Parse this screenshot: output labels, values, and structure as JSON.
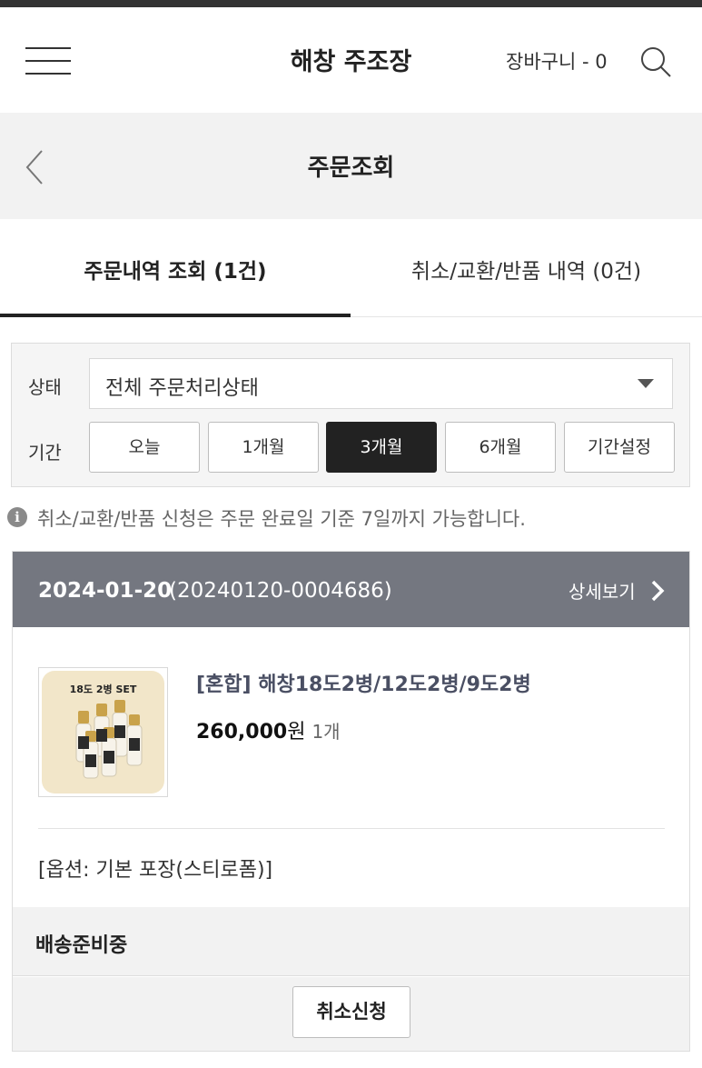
{
  "header": {
    "brand": "해창 주조장",
    "cart_label": "장바구니 - 0"
  },
  "subheader": {
    "title": "주문조회"
  },
  "tabs": [
    {
      "label": "주문내역 조회 (1건)",
      "active": true
    },
    {
      "label": "취소/교환/반품 내역 (0건)",
      "active": false
    }
  ],
  "filter": {
    "status_label": "상태",
    "status_value": "전체 주문처리상태",
    "period_label": "기간",
    "periods": [
      {
        "label": "오늘",
        "active": false
      },
      {
        "label": "1개월",
        "active": false
      },
      {
        "label": "3개월",
        "active": true
      },
      {
        "label": "6개월",
        "active": false
      },
      {
        "label": "기간설정",
        "active": false
      }
    ]
  },
  "notice": {
    "icon": "info-icon",
    "text": "취소/교환/반품 신청은 주문 완료일 기준 7일까지 가능합니다."
  },
  "order": {
    "date": "2024-01-20",
    "order_number": "(20240120-0004686)",
    "detail_label": "상세보기",
    "product": {
      "image_label": "18도 2병 SET",
      "name": "[혼합] 해창18도2병/12도2병/9도2병",
      "price": "260,000",
      "currency": "원",
      "quantity": "1개"
    },
    "option": "[옵션: 기본 포장(스티로폼)]",
    "shipping_status": "배송준비중",
    "cancel_label": "취소신청"
  },
  "colors": {
    "order_header_bg": "#747780",
    "active_period_bg": "#222222",
    "product_name": "#4a4f63"
  }
}
